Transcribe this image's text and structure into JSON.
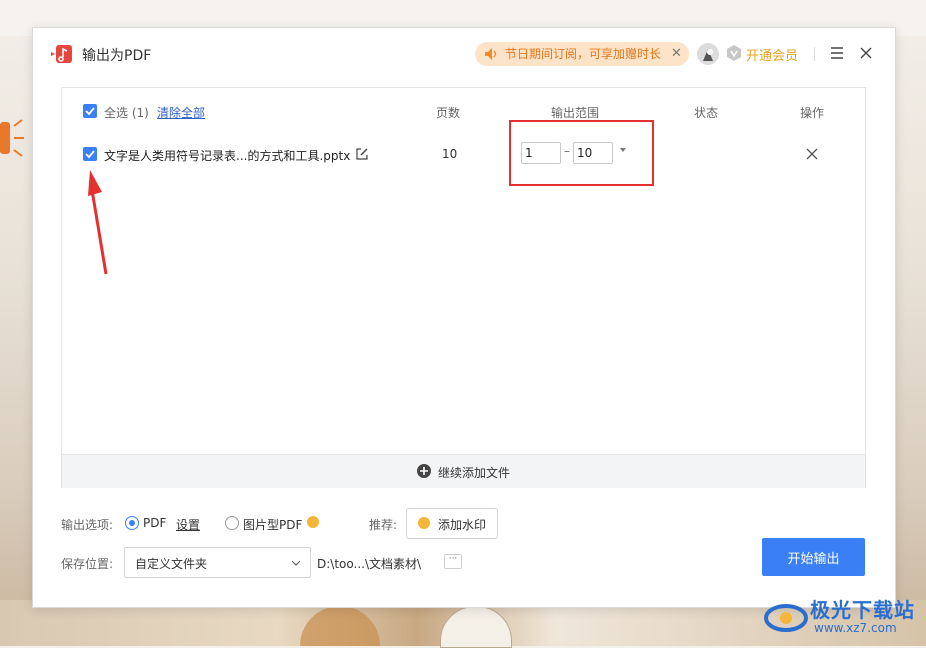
{
  "dialog": {
    "title": "输出为PDF",
    "promo": "节日期间订阅，可享加赠时长",
    "vip_label": "开通会员"
  },
  "file_list": {
    "select_all": "全选 (1)",
    "clear_all": "清除全部",
    "col_pages": "页数",
    "col_range": "输出范围",
    "col_status": "状态",
    "col_action": "操作",
    "rows": [
      {
        "name": "文字是人类用符号记录表...的方式和工具.pptx",
        "pages": "10",
        "range_from": "1",
        "range_to": "10",
        "status": ""
      }
    ],
    "add_more": "继续添加文件"
  },
  "options": {
    "label": "输出选项:",
    "pdf": "PDF",
    "settings": "设置",
    "image_pdf": "图片型PDF",
    "recommend": "推荐:",
    "watermark_btn": "添加水印",
    "selected": "PDF"
  },
  "save": {
    "label": "保存位置:",
    "location": "自定义文件夹",
    "path": "D:\\too...\\文档素材\\",
    "more": "···"
  },
  "start_button": "开始输出",
  "site_watermark": {
    "title": "极光下载站",
    "url": "www.xz7.com"
  },
  "colors": {
    "accent": "#3b7ff6",
    "highlight_box": "#e53030",
    "promo_text": "#e4761b",
    "vip": "#e4a21b"
  }
}
